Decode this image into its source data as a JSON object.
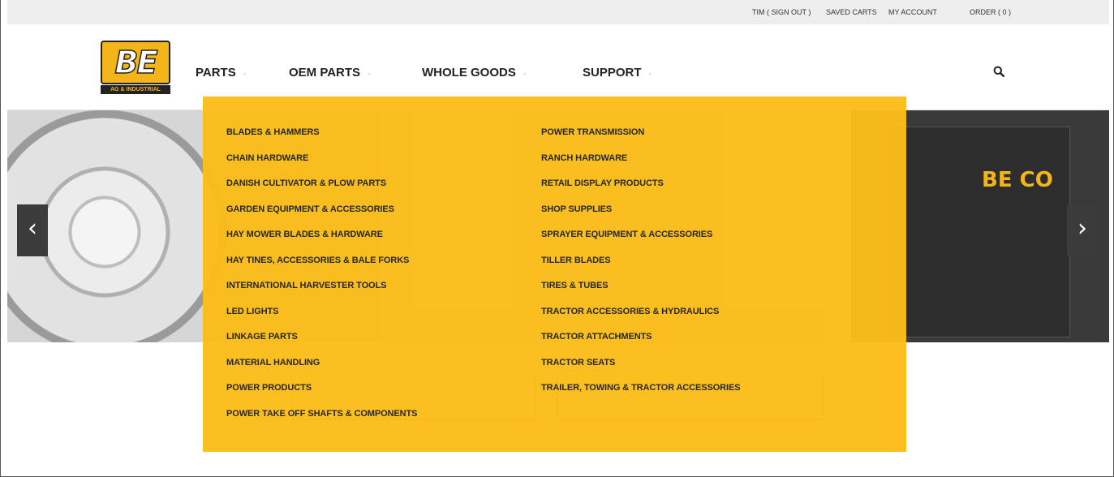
{
  "topbar": {
    "user": "TIM ( SIGN OUT )",
    "saved_carts": "SAVED CARTS",
    "my_account": "MY ACCOUNT",
    "order": "ORDER ( 0 )"
  },
  "logo": {
    "mark": "BE",
    "tagline": "AG & INDUSTRIAL"
  },
  "nav": {
    "parts": "PARTS",
    "oem_parts": "OEM PARTS",
    "whole_goods": "WHOLE GOODS",
    "support": "SUPPORT",
    "caret": "-"
  },
  "hero": {
    "brand": "BE CO"
  },
  "dropdown": {
    "left_column": [
      "BLADES & HAMMERS",
      "CHAIN HARDWARE",
      "DANISH CULTIVATOR & PLOW PARTS",
      "GARDEN EQUIPMENT & ACCESSORIES",
      "HAY MOWER BLADES & HARDWARE",
      "HAY TINES, ACCESSORIES & BALE FORKS",
      "INTERNATIONAL HARVESTER TOOLS",
      "LED LIGHTS",
      "LINKAGE PARTS",
      "MATERIAL HANDLING",
      "POWER PRODUCTS",
      "POWER TAKE OFF SHAFTS & COMPONENTS"
    ],
    "right_column": [
      "POWER TRANSMISSION",
      "RANCH HARDWARE",
      "RETAIL DISPLAY PRODUCTS",
      "SHOP SUPPLIES",
      "SPRAYER EQUIPMENT & ACCESSORIES",
      "TILLER BLADES",
      "TIRES & TUBES",
      "TRACTOR ACCESSORIES & HYDRAULICS",
      "TRACTOR ATTACHMENTS",
      "TRACTOR SEATS",
      "TRAILER, TOWING & TRACTOR ACCESSORIES"
    ]
  },
  "colors": {
    "accent": "#fbbd1b",
    "topbar_bg": "#eeeeee",
    "text": "#222222"
  }
}
